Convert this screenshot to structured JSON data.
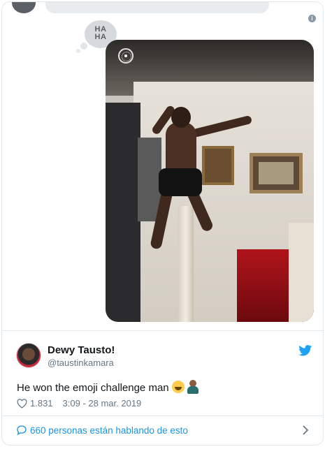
{
  "tweet": {
    "author_name": "Dewy Tausto!",
    "author_handle": "@taustinkamara",
    "text": "He won the emoji challenge man",
    "emojis": [
      "face-with-tears-of-joy",
      "person-facepalming"
    ],
    "likes": "1.831",
    "timestamp": "3:09 - 28 mar. 2019"
  },
  "media": {
    "reaction_label": "HA HA",
    "reaction_line1": "HA",
    "reaction_line2": "HA",
    "live_badge": "live-photo-icon"
  },
  "footer": {
    "conversation_text": "660 personas están hablando de esto"
  },
  "colors": {
    "link_blue": "#1b95e0",
    "twitter_blue": "#1da1f2",
    "muted_gray": "#657786",
    "text_dark": "#14171a",
    "border": "#e1e8ed"
  },
  "icons": {
    "info": "info-icon",
    "brand": "twitter-bird-icon",
    "like": "heart-icon",
    "conversation": "speech-bubble-icon",
    "more": "chevron-right-icon"
  }
}
